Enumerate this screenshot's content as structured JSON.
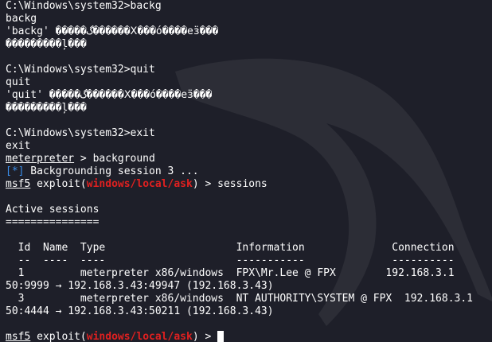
{
  "prompt": "C:\\Windows\\system32>",
  "lines": {
    "l1": "C:\\Windows\\system32>backg",
    "l2": "backg",
    "l3": "'backg' �����گ������Ⅹ���ó����eӟ���",
    "l4": "���������ļ���",
    "l6": "C:\\Windows\\system32>quit",
    "l7": "quit",
    "l8": "'quit' �����گ������Ⅹ���ó����eӟ���",
    "l9": "���������ļ���",
    "l11": "C:\\Windows\\system32>exit",
    "l12": "exit"
  },
  "background_prompt": {
    "meterpreter": "meterpreter",
    "rest": " > background"
  },
  "bg_status": {
    "marker": "[*]",
    "text": " Backgrounding session 3 ..."
  },
  "msf_prompt_1": {
    "msf": "msf5",
    "pre": " exploit(",
    "module": "windows/local/ask",
    "post": ") > ",
    "cmd": "sessions"
  },
  "active_sessions": {
    "title": "Active sessions",
    "underline": "===============",
    "header": "  Id  Name  Type                     Information              Connection",
    "dashes": "  --  ----  ----                     -----------              ----------",
    "rows": [
      {
        "a": "  1         meterpreter x86/windows  FPX\\Mr.Lee @ FPX        192.168.3.1",
        "b": "50:9999 → 192.168.3.43:49947 (192.168.3.43)"
      },
      {
        "a": "  3         meterpreter x86/windows  NT AUTHORITY\\SYSTEM @ FPX  192.168.3.1",
        "b": "50:4444 → 192.168.3.43:50211 (192.168.3.43)"
      }
    ]
  },
  "msf_prompt_2": {
    "msf": "msf5",
    "pre": " exploit(",
    "module": "windows/local/ask",
    "post": ") > "
  },
  "colors": {
    "background": "#1e1f29",
    "text": "#ffffff",
    "info_marker": "#3b8eea",
    "module": "#e02020"
  },
  "icons": {
    "watermark": "kali-dragon-icon"
  }
}
